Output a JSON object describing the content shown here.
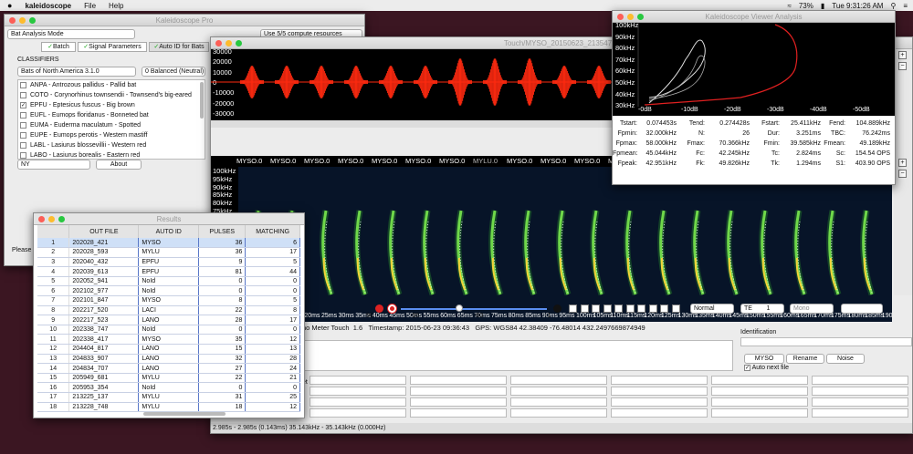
{
  "menubar": {
    "app": "kaleidoscope",
    "items": [
      "File",
      "Help"
    ],
    "battery": "73%",
    "clock": "Tue 9:31:26 AM"
  },
  "pro_window": {
    "title": "Kaleidoscope Pro",
    "mode": "Bat Analysis Mode",
    "compute": "Use 5/5 compute resources",
    "tabs": [
      "Batch",
      "Signal Parameters",
      "Auto ID for Bats"
    ],
    "classifiers_label": "CLASSIFIERS",
    "classifier": "Bats of North America 3.1.0",
    "balance": "0 Balanced (Neutral)",
    "species": [
      {
        "label": "ANPA - Antrozous pallidus - Pallid bat",
        "checked": false
      },
      {
        "label": "COTO - Corynorhinus townsendii - Townsend's big-eared",
        "checked": false
      },
      {
        "label": "EPFU - Eptesicus fuscus - Big brown",
        "checked": true
      },
      {
        "label": "EUFL - Eumops floridanus - Bonneted bat",
        "checked": false
      },
      {
        "label": "EUMA - Euderma maculatum - Spotted",
        "checked": false
      },
      {
        "label": "EUPE - Eumops perotis - Western mastiff",
        "checked": false
      },
      {
        "label": "LABL - Lasiurus blossevillii - Western red",
        "checked": false
      },
      {
        "label": "LABO - Lasiurus borealis - Eastern red",
        "checked": false
      }
    ],
    "region": "NY",
    "about": "About",
    "please": "Please"
  },
  "viewer": {
    "title": "Touch/MYSO_20150623_213547.w",
    "wave_ticks": [
      "30000",
      "20000",
      "10000",
      "0",
      "-10000",
      "-20000",
      "-30000"
    ],
    "freq_ticks": [
      "100kHz",
      "95kHz",
      "90kHz",
      "85kHz",
      "80kHz",
      "75kHz",
      "70kHz",
      "65kHz",
      "60kHz",
      "55kHz",
      "50kHz"
    ],
    "time_ticks": [
      "0ms",
      "5ms",
      "10ms",
      "15ms",
      "20ms",
      "25ms",
      "30ms",
      "35ms",
      "40ms",
      "45ms",
      "50ms",
      "55ms",
      "60ms",
      "65ms",
      "70ms",
      "75ms",
      "80ms",
      "85ms",
      "90ms",
      "95ms",
      "100ms",
      "105ms",
      "110ms",
      "115ms",
      "120ms",
      "125ms",
      "130ms",
      "135ms",
      "140ms",
      "145ms",
      "150ms",
      "155ms",
      "160ms",
      "165ms",
      "170ms",
      "175ms",
      "180ms",
      "185ms",
      "190ms",
      "195ms"
    ],
    "labels": [
      "MYSO.0",
      "MYSO.0",
      "MYSO.0",
      "MYSO.0",
      "MYSO.0",
      "MYSO.0",
      "MYSO.0",
      "MYLU.0",
      "MYSO.0",
      "MYSO.0",
      "MYSO.0",
      "MYSO.0",
      "MYSO.0",
      "MYSO.0",
      "MYSO.0",
      "MYSO.0",
      "MYSO.0",
      "MYLU.2"
    ],
    "db_ticks": [
      "-96",
      "-60",
      "-1"
    ],
    "db_left": "96",
    "view": "Normal",
    "te": "TE",
    "te_val": "1",
    "channel": "Mono",
    "info_device": "ho Meter Touch",
    "info_ver": "1.6",
    "info_ts": "Timestamp: 2015-06-23 09:36:43",
    "info_gps": "GPS: WGS84 42.38409 -76.48014 432.2497669874949",
    "identification": "Identification",
    "id_buttons": [
      "MYSO",
      "Rename",
      "Noise"
    ],
    "auto_next": "Auto next file",
    "status": "2.985s - 2.985s (0.143ms) 35.143kHz - 35.143kHz (0.000Hz)",
    "et": "et"
  },
  "analysis": {
    "title": "Kaleidoscope Viewer Analysis",
    "freq_ticks": [
      "100kHz",
      "90kHz",
      "80kHz",
      "70kHz",
      "60kHz",
      "50kHz",
      "40kHz",
      "30kHz"
    ],
    "db_ticks": [
      "-0dB",
      "-10dB",
      "-20dB",
      "-30dB",
      "-40dB",
      "-50dB"
    ],
    "stats": [
      [
        [
          "Tstart:",
          "0.074453s"
        ],
        [
          "Tend:",
          "0.274428s"
        ],
        [
          "Fstart:",
          "25.411kHz"
        ],
        [
          "Fend:",
          "104.889kHz"
        ]
      ],
      [
        [
          "Fpmin:",
          "32.000kHz"
        ],
        [
          "N:",
          "26"
        ],
        [
          "Dur:",
          "3.251ms"
        ],
        [
          "TBC:",
          "76.242ms"
        ]
      ],
      [
        [
          "Fpmax:",
          "58.000kHz"
        ],
        [
          "Fmax:",
          "70.366kHz"
        ],
        [
          "Fmin:",
          "39.585kHz"
        ],
        [
          "Fmean:",
          "49.189kHz"
        ]
      ],
      [
        [
          "Fpmean:",
          "45.044kHz"
        ],
        [
          "Fc:",
          "42.245kHz"
        ],
        [
          "Tc:",
          "2.824ms"
        ],
        [
          "Sc:",
          "154.54 OPS"
        ]
      ],
      [
        [
          "Fpeak:",
          "42.951kHz"
        ],
        [
          "Fk:",
          "49.826kHz"
        ],
        [
          "Tk:",
          "1.294ms"
        ],
        [
          "S1:",
          "403.90 OPS"
        ]
      ]
    ]
  },
  "results": {
    "title": "Results",
    "headers": [
      "OUT FILE",
      "AUTO ID",
      "PULSES",
      "MATCHING"
    ],
    "rows": [
      [
        "1",
        "202028_421",
        "MYSO",
        "36",
        "6"
      ],
      [
        "2",
        "202028_593",
        "MYLU",
        "36",
        "17"
      ],
      [
        "3",
        "202040_432",
        "EPFU",
        "9",
        "5"
      ],
      [
        "4",
        "202039_613",
        "EPFU",
        "81",
        "44"
      ],
      [
        "5",
        "202052_941",
        "NoId",
        "0",
        "0"
      ],
      [
        "6",
        "202102_977",
        "NoId",
        "0",
        "0"
      ],
      [
        "7",
        "202101_847",
        "MYSO",
        "8",
        "5"
      ],
      [
        "8",
        "202217_520",
        "LACI",
        "22",
        "8"
      ],
      [
        "9",
        "202217_523",
        "LANO",
        "28",
        "17"
      ],
      [
        "10",
        "202338_747",
        "NoId",
        "0",
        "0"
      ],
      [
        "11",
        "202338_417",
        "MYSO",
        "35",
        "12"
      ],
      [
        "12",
        "204404_817",
        "LANO",
        "15",
        "13"
      ],
      [
        "13",
        "204833_907",
        "LANO",
        "32",
        "28"
      ],
      [
        "14",
        "204834_707",
        "LANO",
        "27",
        "24"
      ],
      [
        "15",
        "205949_681",
        "MYLU",
        "22",
        "21"
      ],
      [
        "16",
        "205953_354",
        "NoId",
        "0",
        "0"
      ],
      [
        "17",
        "213225_137",
        "MYLU",
        "31",
        "25"
      ],
      [
        "18",
        "213228_748",
        "MYLU",
        "18",
        "12"
      ]
    ]
  }
}
